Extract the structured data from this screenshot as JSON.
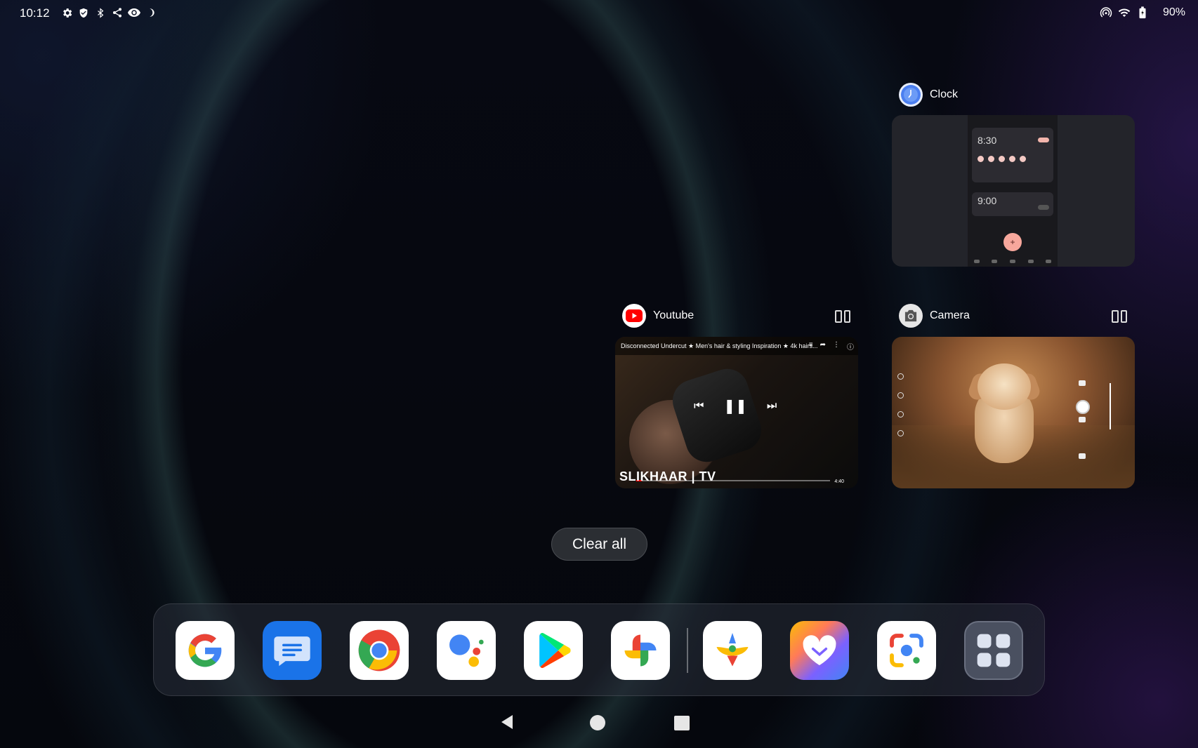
{
  "status_bar": {
    "time": "10:12",
    "battery": "90%",
    "left_icons": [
      "settings-icon",
      "shield-icon",
      "bluetooth-icon",
      "share-icon",
      "eye-icon",
      "moon-icon"
    ],
    "right_icons": [
      "hotspot-icon",
      "wifi-icon",
      "battery-icon"
    ]
  },
  "recents": {
    "clock": {
      "app_name": "Clock",
      "alarm_1": "8:30",
      "alarm_2": "9:00"
    },
    "youtube": {
      "app_name": "Youtube",
      "video_title": "Disconnected Undercut ★ Men's hair & styling Inspiration ★ 4k hairs...",
      "channel_logo": "SLIKHAAR | TV",
      "duration": "4:40"
    },
    "camera": {
      "app_name": "Camera"
    },
    "clear_all_label": "Clear all"
  },
  "dock": {
    "apps": [
      "Google",
      "Messages",
      "Chrome",
      "Assistant",
      "Play Store",
      "Photos",
      "Tips",
      "Health",
      "Lens",
      "All apps"
    ]
  },
  "colors": {
    "accent_blue": "#4285F4",
    "accent_red": "#EA4335",
    "accent_yellow": "#FBBC05",
    "accent_green": "#34A853"
  }
}
